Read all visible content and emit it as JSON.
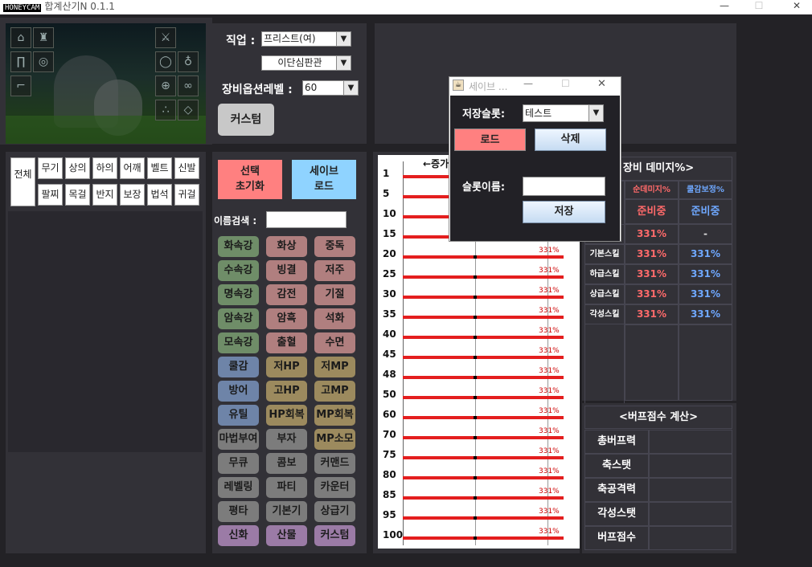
{
  "window": {
    "title": "합계산기N 0.1.1",
    "watermark": "HONEYCAM",
    "controls": [
      "—",
      "☐",
      "✕"
    ]
  },
  "equipment_slots": [
    "shirt-icon",
    "coat-icon",
    "pants-icon",
    "belt-icon",
    "shoes-icon",
    "weapon-icon",
    "bracelet-icon",
    "ring-icon",
    "orb-icon",
    "necklace-icon",
    "earring-icon",
    "gem-icon"
  ],
  "job": {
    "label": "직업 :",
    "value": "프리스트(여)",
    "subclass": "이단심판관"
  },
  "level": {
    "label": "장비옵션레벨 :",
    "value": "60"
  },
  "custom_button": "커스텀",
  "tabs": {
    "all": "전체",
    "row1": [
      "무기",
      "상의",
      "하의",
      "어깨",
      "벨트",
      "신발"
    ],
    "row2": [
      "팔찌",
      "목걸",
      "반지",
      "보장",
      "법석",
      "귀걸"
    ]
  },
  "action_buttons": {
    "reset": [
      "선택",
      "초기화"
    ],
    "saveload": [
      "세이브",
      "로드"
    ]
  },
  "search": {
    "label": "이름검색 :",
    "value": ""
  },
  "chips": [
    [
      {
        "t": "화속강",
        "c": "c-g"
      },
      {
        "t": "화상",
        "c": "c-r"
      },
      {
        "t": "중독",
        "c": "c-r"
      }
    ],
    [
      {
        "t": "수속강",
        "c": "c-g"
      },
      {
        "t": "빙결",
        "c": "c-r"
      },
      {
        "t": "저주",
        "c": "c-r"
      }
    ],
    [
      {
        "t": "명속강",
        "c": "c-g"
      },
      {
        "t": "감전",
        "c": "c-r"
      },
      {
        "t": "기절",
        "c": "c-r"
      }
    ],
    [
      {
        "t": "암속강",
        "c": "c-g"
      },
      {
        "t": "암흑",
        "c": "c-r"
      },
      {
        "t": "석화",
        "c": "c-r"
      }
    ],
    [
      {
        "t": "모속강",
        "c": "c-g"
      },
      {
        "t": "출혈",
        "c": "c-r"
      },
      {
        "t": "수면",
        "c": "c-r"
      }
    ],
    [
      {
        "t": "쿨감",
        "c": "c-b"
      },
      {
        "t": "저HP",
        "c": "c-y"
      },
      {
        "t": "저MP",
        "c": "c-y"
      }
    ],
    [
      {
        "t": "방어",
        "c": "c-b"
      },
      {
        "t": "고HP",
        "c": "c-y"
      },
      {
        "t": "고MP",
        "c": "c-y"
      }
    ],
    [
      {
        "t": "유틸",
        "c": "c-b"
      },
      {
        "t": "HP회복",
        "c": "c-y"
      },
      {
        "t": "MP회복",
        "c": "c-y"
      }
    ],
    [
      {
        "t": "마법부여",
        "c": "c-gr"
      },
      {
        "t": "부자",
        "c": "c-gr"
      },
      {
        "t": "MP소모",
        "c": "c-y"
      }
    ],
    [
      {
        "t": "무큐",
        "c": "c-gr"
      },
      {
        "t": "콤보",
        "c": "c-gr"
      },
      {
        "t": "커맨드",
        "c": "c-gr"
      }
    ],
    [
      {
        "t": "레벨링",
        "c": "c-gr"
      },
      {
        "t": "파티",
        "c": "c-gr"
      },
      {
        "t": "카운터",
        "c": "c-gr"
      }
    ],
    [
      {
        "t": "평타",
        "c": "c-gr"
      },
      {
        "t": "기본기",
        "c": "c-gr"
      },
      {
        "t": "상급기",
        "c": "c-gr"
      }
    ],
    [
      {
        "t": "신화",
        "c": "c-p"
      },
      {
        "t": "산물",
        "c": "c-p"
      },
      {
        "t": "커스텀",
        "c": "c-p"
      }
    ]
  ],
  "chart": {
    "header": "←증가",
    "levels": [
      "1",
      "5",
      "10",
      "15",
      "20",
      "25",
      "30",
      "35",
      "40",
      "45",
      "48",
      "50",
      "60",
      "70",
      "75",
      "80",
      "85",
      "95",
      "100"
    ],
    "value_label": "331%"
  },
  "damage_table": {
    "title": "장비 데미지%>",
    "col_headers": [
      "순데미지%",
      "쿨감보정%"
    ],
    "status": [
      "준비중",
      "준비중"
    ],
    "rows": [
      {
        "name": "",
        "v1": "331%",
        "v2": "-"
      },
      {
        "name": "기본스킬",
        "v1": "331%",
        "v2": "331%"
      },
      {
        "name": "하급스킬",
        "v1": "331%",
        "v2": "331%"
      },
      {
        "name": "상급스킬",
        "v1": "331%",
        "v2": "331%"
      },
      {
        "name": "각성스킬",
        "v1": "331%",
        "v2": "331%"
      }
    ]
  },
  "buff": {
    "title": "<버프점수 계산>",
    "rows": [
      "총버프력",
      "축스탯",
      "축공격력",
      "각성스탯",
      "버프점수"
    ]
  },
  "dialog": {
    "title": "세이브 ...",
    "slot_label": "저장슬롯:",
    "slot_value": "테스트",
    "load": "로드",
    "delete": "삭제",
    "name_label": "슬롯이름:",
    "name_value": "",
    "save": "저장"
  }
}
